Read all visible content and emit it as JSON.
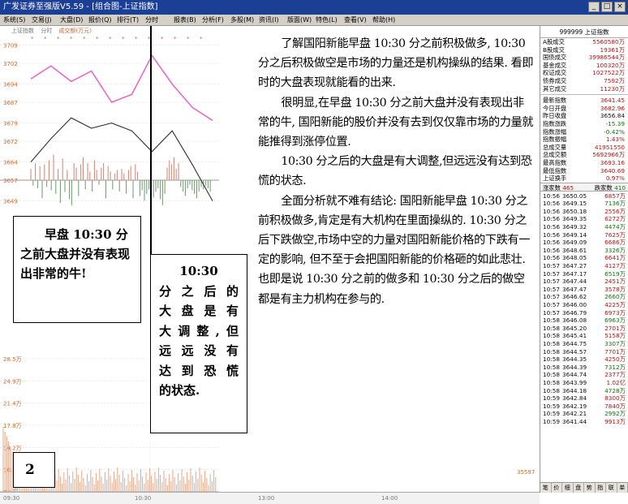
{
  "window": {
    "title": "广发证券至强版V5.59 - [组合图-上证指数]",
    "controls": [
      "_",
      "□",
      "×"
    ]
  },
  "menu": [
    "系统(S)",
    "交易(J)",
    "大盘(D)",
    "报价(Q)",
    "排行(T)",
    "分时",
    "报表(B)",
    "分析(F)",
    "多股(M)",
    "资讯(I)",
    "版面(W)",
    "特色(L)",
    "查看(V)",
    "帮助(H)"
  ],
  "chart": {
    "header": {
      "index": "上证指数",
      "mode": "分时",
      "volume_label": "成交额(万元)"
    },
    "price_labels": [
      "3709",
      "3702",
      "3694",
      "3687",
      "3679",
      "3672",
      "3664",
      "3657",
      "3649"
    ],
    "volume_labels": [
      "28.5万",
      "24.9万",
      "21.4万",
      "17.8万",
      "14.2万",
      "10.7万",
      "7.1万"
    ],
    "right_axis_label": "35597",
    "time_labels": [
      "09:30",
      "10:30",
      "13:00",
      "14:00"
    ],
    "chart_data": {
      "type": "line",
      "x": [
        "09:30",
        "09:40",
        "09:50",
        "10:00",
        "10:10",
        "10:20",
        "10:30",
        "10:40",
        "10:50",
        "11:00"
      ],
      "series": [
        {
          "values": [
            3696,
            3701,
            3695,
            3699,
            3687,
            3690,
            3705,
            3694,
            3685,
            3680
          ]
        },
        {
          "values": [
            3664,
            3673,
            3681,
            3677,
            3679,
            3676,
            3668,
            3676,
            3663,
            3649
          ]
        }
      ],
      "ylim": [
        3642,
        3712
      ]
    }
  },
  "callouts": {
    "box1": "早盘 10:30 分之前大盘并没有表现出非常的牛!",
    "box2": [
      "10:30",
      "分之后的",
      "大盘是有",
      "大调整,但",
      "远远没有",
      "达到恐慌",
      "的状态."
    ],
    "box3": "2"
  },
  "article": {
    "paragraphs": [
      "了解国阳新能早盘 10:30 分之前积极做多, 10:30 分之后积极做空是市场的力量还是机构操纵的结果. 看即时的大盘表现就能看的出来.",
      "很明显,在早盘 10:30 分之前大盘并没有表现出非常的牛, 国阳新能的股价并没有去到仅仅靠市场的力量就能推得到涨停位置.",
      "10:30 分之后的大盘是有大调整,但远远没有达到恐慌的状态.",
      "全面分析就不难有结论: 国阳新能早盘 10:30 分之前积极做多,肯定是有大机构在里面操纵的. 10:30 分之后下跌做空,市场中空的力量对国阳新能价格的下跌有一定的影响, 但不至于会把国阳新能的价格砸的如此悲壮. 也即是说 10:30 分之前的做多和 10:30 分之后的做空都是有主力机构在参与的."
    ]
  },
  "panel": {
    "title": "999999 上证指数",
    "stats": [
      {
        "k": "A股成交",
        "v": "5560580万"
      },
      {
        "k": "B股成交",
        "v": "19361万"
      },
      {
        "k": "国债成交",
        "v": "39986544万"
      },
      {
        "k": "基金成交",
        "v": "100320万"
      },
      {
        "k": "权证成交",
        "v": "1027522万"
      },
      {
        "k": "债券成交",
        "v": "7592万"
      },
      {
        "k": "其它成交",
        "v": "11230万"
      }
    ],
    "quote": [
      {
        "k": "最新指数",
        "v": "3641.45"
      },
      {
        "k": "今日开盘",
        "v": "3682.96"
      },
      {
        "k": "昨日收盘",
        "v": "3656.84"
      },
      {
        "k": "指数涨跌",
        "v": "-15.39"
      },
      {
        "k": "指数涨幅",
        "v": "-0.42%"
      },
      {
        "k": "指数振幅",
        "v": "1.43%"
      },
      {
        "k": "总成交量",
        "v": "41951550"
      },
      {
        "k": "总成交额",
        "v": "5692966万"
      },
      {
        "k": "最高指数",
        "v": "3693.16"
      },
      {
        "k": "最低指数",
        "v": "3640.69"
      },
      {
        "k": "上证换手",
        "v": "0.97%"
      }
    ],
    "up_label": "涨家数",
    "up_count": "465",
    "down_label": "跌家数",
    "down_count": "410",
    "trades": [
      {
        "t": "10:56",
        "p": "3650.05",
        "v": "6857万"
      },
      {
        "t": "10:56",
        "p": "3649.15",
        "v": "7136万"
      },
      {
        "t": "10:56",
        "p": "3650.18",
        "v": "2556万"
      },
      {
        "t": "10:56",
        "p": "3649.35",
        "v": "6272万"
      },
      {
        "t": "10:56",
        "p": "3649.32",
        "v": "4474万"
      },
      {
        "t": "10:56",
        "p": "3649.14",
        "v": "7625万"
      },
      {
        "t": "10:56",
        "p": "3649.09",
        "v": "6686万"
      },
      {
        "t": "10:56",
        "p": "3648.61",
        "v": "3326万"
      },
      {
        "t": "10:56",
        "p": "3648.05",
        "v": "6641万"
      },
      {
        "t": "10:57",
        "p": "3647.27",
        "v": "4127万"
      },
      {
        "t": "10:57",
        "p": "3647.17",
        "v": "6519万"
      },
      {
        "t": "10:57",
        "p": "3647.44",
        "v": "2451万"
      },
      {
        "t": "10:57",
        "p": "3647.47",
        "v": "3578万"
      },
      {
        "t": "10:57",
        "p": "3646.62",
        "v": "2660万"
      },
      {
        "t": "10:57",
        "p": "3646.00",
        "v": "4225万"
      },
      {
        "t": "10:57",
        "p": "3646.79",
        "v": "6973万"
      },
      {
        "t": "10:58",
        "p": "3646.08",
        "v": "6963万"
      },
      {
        "t": "10:58",
        "p": "3645.20",
        "v": "2701万"
      },
      {
        "t": "10:58",
        "p": "3645.41",
        "v": "5158万"
      },
      {
        "t": "10:58",
        "p": "3644.75",
        "v": "3307万"
      },
      {
        "t": "10:58",
        "p": "3644.57",
        "v": "7701万"
      },
      {
        "t": "10:58",
        "p": "3644.35",
        "v": "4250万"
      },
      {
        "t": "10:58",
        "p": "3644.39",
        "v": "7312万"
      },
      {
        "t": "10:58",
        "p": "3644.74",
        "v": "2377万"
      },
      {
        "t": "10:58",
        "p": "3643.99",
        "v": "1.02亿"
      },
      {
        "t": "10:58",
        "p": "3644.18",
        "v": "4728万"
      },
      {
        "t": "10:59",
        "p": "3642.84",
        "v": "8300万"
      },
      {
        "t": "10:59",
        "p": "3642.19",
        "v": "7840万"
      },
      {
        "t": "10:59",
        "p": "3642.21",
        "v": "2992万"
      },
      {
        "t": "10:59",
        "p": "3641.44",
        "v": "9913万"
      }
    ],
    "bottom_tabs": [
      "笔",
      "价",
      "细",
      "盘",
      "势",
      "指",
      "联",
      "单"
    ]
  }
}
